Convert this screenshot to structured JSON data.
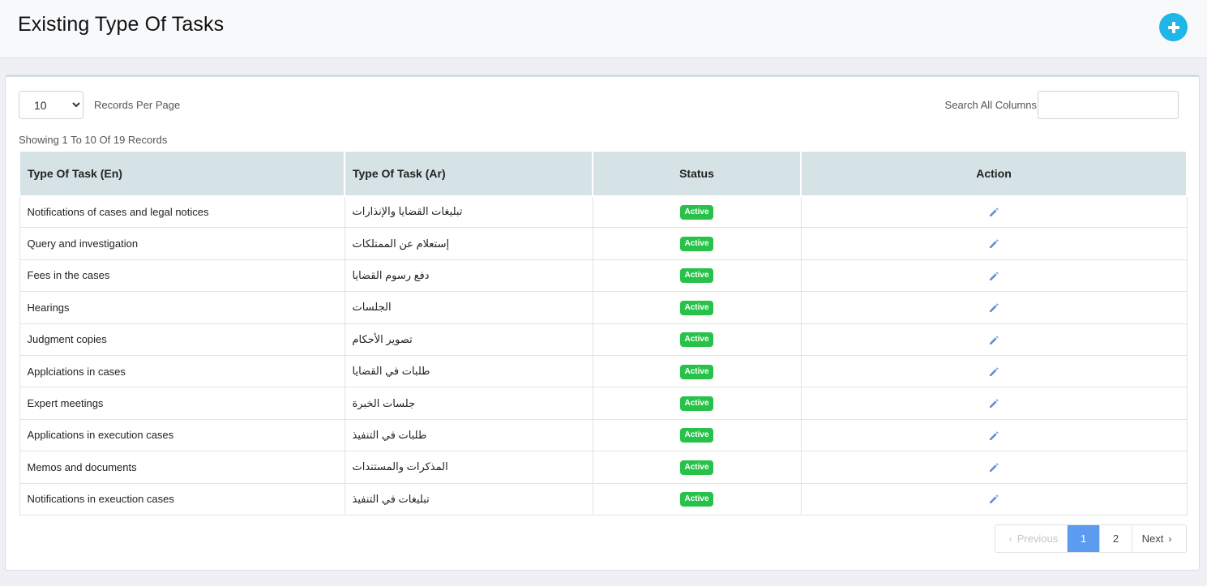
{
  "header": {
    "title": "Existing Type Of Tasks",
    "add_icon": "plus-circle-icon",
    "accent_color": "#1fb6e8"
  },
  "controls": {
    "records_per_page_value": "10",
    "records_per_page_options": [
      "10"
    ],
    "records_per_page_label": "Records Per Page",
    "search_label": "Search All Columns",
    "search_value": "",
    "info": "Showing 1 To 10 Of 19 Records"
  },
  "table": {
    "columns": [
      "Type Of Task (En)",
      "Type Of Task (Ar)",
      "Status",
      "Action"
    ],
    "rows": [
      {
        "en": "Notifications of cases and legal notices",
        "ar": "تبليغات القضايا والإنذارات",
        "status": "Active"
      },
      {
        "en": "Query and investigation",
        "ar": "إستعلام عن الممتلكات",
        "status": "Active"
      },
      {
        "en": "Fees in the cases",
        "ar": "دفع رسوم القضايا",
        "status": "Active"
      },
      {
        "en": "Hearings",
        "ar": "الجلسات",
        "status": "Active"
      },
      {
        "en": "Judgment copies",
        "ar": "تصوير الأحكام",
        "status": "Active"
      },
      {
        "en": "Applciations in cases",
        "ar": "طلبات في القضايا",
        "status": "Active"
      },
      {
        "en": "Expert meetings",
        "ar": "جلسات الخبرة",
        "status": "Active"
      },
      {
        "en": "Applications in execution cases",
        "ar": "طلبات في التنفيذ",
        "status": "Active"
      },
      {
        "en": "Memos and documents",
        "ar": "المذكرات والمستندات",
        "status": "Active"
      },
      {
        "en": "Notifications in exeuction cases",
        "ar": "تبليغات في التنفيذ",
        "status": "Active"
      }
    ],
    "status_color": "#28c24a",
    "action_icon": "pencil-icon"
  },
  "pagination": {
    "previous_label": "Previous",
    "pages": [
      "1",
      "2"
    ],
    "current_page": "1",
    "next_label": "Next",
    "active_color": "#5b9cf0"
  }
}
